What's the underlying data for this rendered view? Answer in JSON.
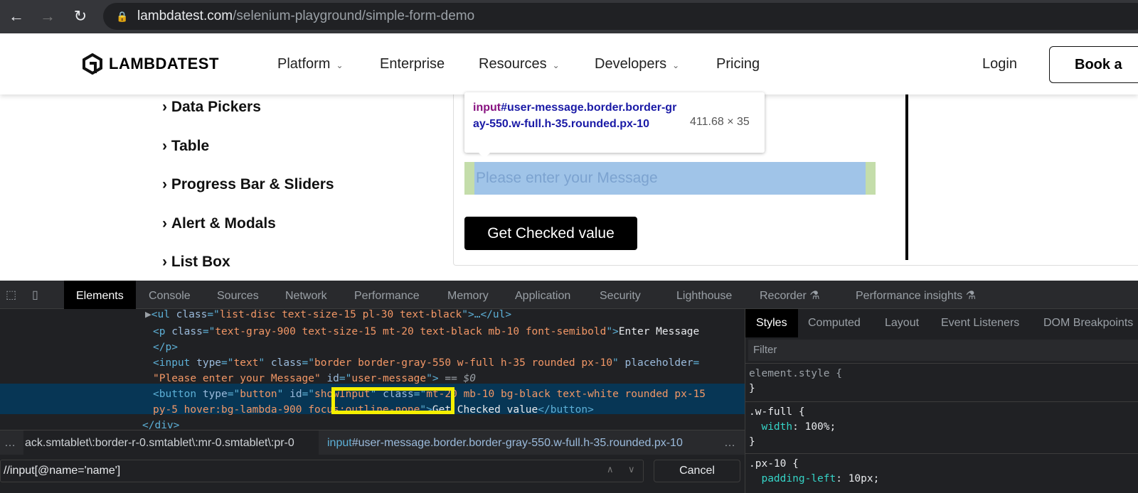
{
  "browser": {
    "url_host": "lambdatest.com",
    "url_path": "/selenium-playground/simple-form-demo"
  },
  "nav": {
    "logo": "LAMBDATEST",
    "items": [
      "Platform",
      "Enterprise",
      "Resources",
      "Developers",
      "Pricing"
    ],
    "login": "Login",
    "book": "Book a"
  },
  "sidebar": [
    "Data Pickers",
    "Table",
    "Progress Bar & Sliders",
    "Alert & Modals",
    "List Box"
  ],
  "tooltip": {
    "tag": "input",
    "selector": "#user-message.border.border-gray-550.w-full.h-35.rounded.px-10",
    "size": "411.68 × 35"
  },
  "form": {
    "placeholder": "Please enter your Message",
    "button": "Get Checked value"
  },
  "devtools": {
    "tabs": [
      "Elements",
      "Console",
      "Sources",
      "Network",
      "Performance",
      "Memory",
      "Application",
      "Security",
      "Lighthouse",
      "Recorder",
      "Performance insights"
    ],
    "code": {
      "l1a": "<ul ",
      "l1b": "class",
      "l1c": "=\"",
      "l1d": "list-disc text-size-15 pl-30 text-black",
      "l1e": "\">…</ul>",
      "l2a": "<p ",
      "l2b": "class",
      "l2d": "text-gray-900 text-size-15 mt-20 text-black mb-10 font-semibold",
      "l2e": "\">",
      "l2f": "Enter Message",
      "l3": "</p>",
      "l4a": "<input ",
      "l4b": "type",
      "l4c": "text",
      "l4d": "class",
      "l4e": "border border-gray-550 w-full h-35 rounded px-10",
      "l4f": "placeholder",
      "l5a": "\"Please enter your Message\"",
      "l5b": "id",
      "l5c": "user-message",
      "l5d": " == $0",
      "l6a": "<button ",
      "l6b": "type",
      "l6c": "button",
      "l6d": "id",
      "l6e": "showInput",
      "l6f": "class",
      "l6g": "mt-20 mb-10 bg-black text-white rounded px-15",
      "l7a": "py-5 hover:bg-lambda-900 focus:outline-none",
      "l7b": "Get Checked value",
      "l7c": "</button>",
      "l8": "</div>"
    },
    "breadcrumb_prev": "ack.smtablet\\:border-r-0.smtablet\\:mr-0.smtablet\\:pr-0",
    "breadcrumb_tag": "input",
    "breadcrumb_rest": "#user-message.border.border-gray-550.w-full.h-35.rounded.px-10",
    "search_value": "//input[@name='name']",
    "cancel": "Cancel",
    "style_tabs": [
      "Styles",
      "Computed",
      "Layout",
      "Event Listeners",
      "DOM Breakpoints"
    ],
    "filter": "Filter",
    "rules": {
      "r1": "element.style {",
      "close": "}",
      "r2": ".w-full {",
      "r2p": "width",
      "r2v": ": 100%;",
      "r3": ".px-10 {",
      "r3p": "padding-left",
      "r3v": ": 10px;"
    }
  }
}
